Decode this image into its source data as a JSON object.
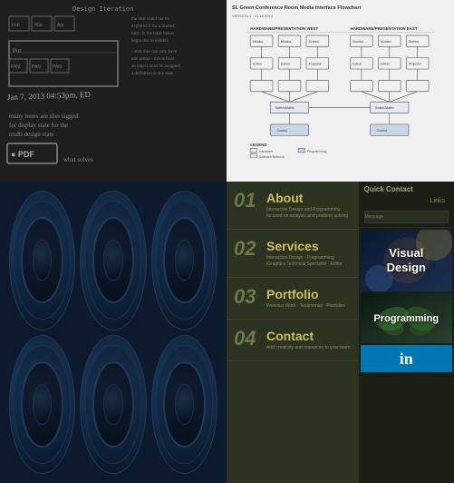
{
  "grid": {
    "cells": {
      "topLeft": {
        "label": "Chalkboard sketch",
        "altText": "Design notes on chalkboard"
      },
      "topRight": {
        "title": "SL Green Conference Room Media Interface Flowchart",
        "subtitle": "VERSION 1 - 01.16.2013",
        "label": "Flowchart diagram"
      },
      "midLeft": {
        "label": "Speaker grid",
        "speakerCount": 6
      },
      "botRight": {
        "label": "Website navigation",
        "sidebarTitle": "Quick Contact",
        "messagePlaceholder": "Message",
        "linksLabel": "Links",
        "menuItems": [
          {
            "number": "01",
            "title": "About",
            "desc": "Interaction Design and Programming focused\non analysis and problem solving"
          },
          {
            "number": "02",
            "title": "Services",
            "desc": "Interaction Design · Programming · iGraphics\nTechnical Specialist · Editor"
          },
          {
            "number": "03",
            "title": "Portfolio",
            "desc": "Previous Work · Testimonial · Portfolios"
          },
          {
            "number": "04",
            "title": "Contact",
            "desc": "Add creativity and resources to your team"
          }
        ],
        "cards": [
          {
            "type": "visual-design",
            "text": "Visual\nDesign"
          },
          {
            "type": "programming",
            "text": "Programming"
          },
          {
            "type": "linkedin",
            "text": "in"
          }
        ]
      }
    }
  }
}
